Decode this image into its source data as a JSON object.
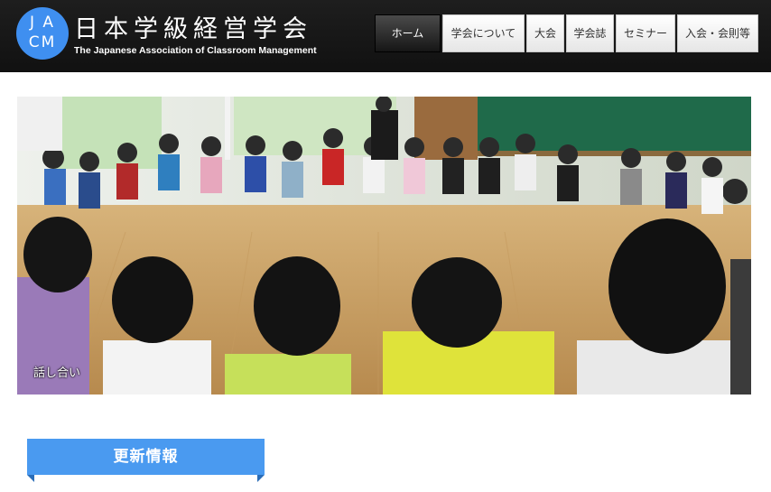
{
  "header": {
    "logo": {
      "line1": "J A",
      "line2": "CM"
    },
    "title": "日本学級経営学会",
    "subtitle": "The Japanese Association of Classroom Management"
  },
  "nav": {
    "items": [
      {
        "label": "ホーム",
        "active": true
      },
      {
        "label": "学会について",
        "active": false
      },
      {
        "label": "大会",
        "active": false
      },
      {
        "label": "学会誌",
        "active": false
      },
      {
        "label": "セミナー",
        "active": false
      },
      {
        "label": "入会・会則等",
        "active": false
      }
    ]
  },
  "hero": {
    "caption": "話し合い",
    "image_description_icon": "classroom-photo"
  },
  "section": {
    "heading": "更新情報"
  },
  "colors": {
    "header_bg": "#1e1e1e",
    "logo_accent": "#3f8ff0",
    "heading_bg": "#4a9af0"
  }
}
